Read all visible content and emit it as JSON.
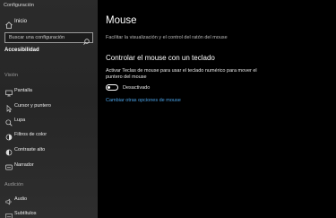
{
  "window": {
    "title": "Configuración"
  },
  "sidebar": {
    "home_label": "Inicio",
    "search_placeholder": "Buscar una configuración",
    "section_title": "Accesibilidad",
    "groups": [
      {
        "label": "Visión",
        "items": [
          {
            "label": "Pantalla",
            "icon": "display-icon"
          },
          {
            "label": "Cursor y puntero",
            "icon": "cursor-icon"
          },
          {
            "label": "Lupa",
            "icon": "magnifier-icon"
          },
          {
            "label": "Filtros de color",
            "icon": "color-filter-icon"
          },
          {
            "label": "Contraste alto",
            "icon": "high-contrast-icon"
          },
          {
            "label": "Narrador",
            "icon": "narrator-icon"
          }
        ]
      },
      {
        "label": "Audición",
        "items": [
          {
            "label": "Audio",
            "icon": "speaker-icon"
          },
          {
            "label": "Subtítulos",
            "icon": "subtitles-icon"
          }
        ]
      }
    ]
  },
  "main": {
    "title": "Mouse",
    "description": "Facilitar la visualización y el control del ratón del mouse",
    "section_title": "Controlar el mouse con un teclado",
    "setting_description": "Activar Teclas de mouse para usar el teclado numérico para mover el puntero del mouse",
    "toggle_state": "Desactivado",
    "link_label": "Cambiar otras opciones de mouse"
  },
  "colors": {
    "accent": "#4aa3e8",
    "sidebar_bg": "#2a2a2a",
    "main_bg": "#000000"
  }
}
